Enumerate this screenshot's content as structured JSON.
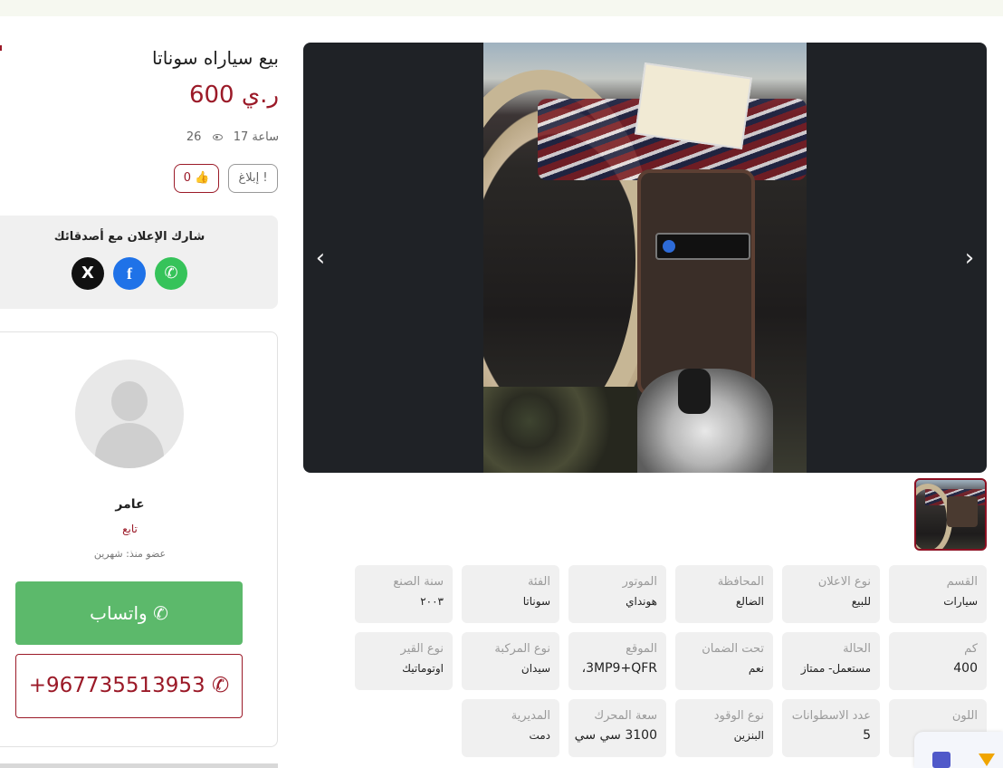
{
  "listing": {
    "title": "بيع سياراه سوناتا",
    "price": "600 ر.ي",
    "age": "17 ساعة",
    "views": "26",
    "report_label": "إبلاغ",
    "likes": "0"
  },
  "share": {
    "label": "شارك الإعلان مع أصدقائك",
    "x": "X",
    "facebook": "f",
    "whatsapp": "✆"
  },
  "seller": {
    "name": "عامر",
    "role": "تابع",
    "member_since": "عضو منذ: شهرين",
    "whatsapp_label": "واتساب",
    "whatsapp_icon": "✆",
    "phone": "+967735513953",
    "phone_icon": "✆"
  },
  "gallery": {
    "prev": "‹",
    "next": "›"
  },
  "specs": [
    {
      "key": "القسم",
      "value": "سيارات"
    },
    {
      "key": "نوع الاعلان",
      "value": "للبيع"
    },
    {
      "key": "المحافظة",
      "value": "الضالع"
    },
    {
      "key": "الموتور",
      "value": "هونداي"
    },
    {
      "key": "الفئة",
      "value": "سوناتا"
    },
    {
      "key": "سنة الصنع",
      "value": "٢٠٠٣"
    },
    {
      "key": "كم",
      "value": "400"
    },
    {
      "key": "الحالة",
      "value": "مستعمل- ممتاز"
    },
    {
      "key": "تحت الضمان",
      "value": "نعم"
    },
    {
      "key": "الموقع",
      "value": "3MP9+QFR، "
    },
    {
      "key": "نوع المركبة",
      "value": "سيدان"
    },
    {
      "key": "نوع القير",
      "value": "اوتوماتيك"
    },
    {
      "key": "اللون",
      "value": ""
    },
    {
      "key": "عدد الاسطوانات",
      "value": "5"
    },
    {
      "key": "نوع الوقود",
      "value": "البنزين"
    },
    {
      "key": "سعة المحرك",
      "value": "3100 سي سي"
    },
    {
      "key": "المديرية",
      "value": "دمت"
    }
  ]
}
